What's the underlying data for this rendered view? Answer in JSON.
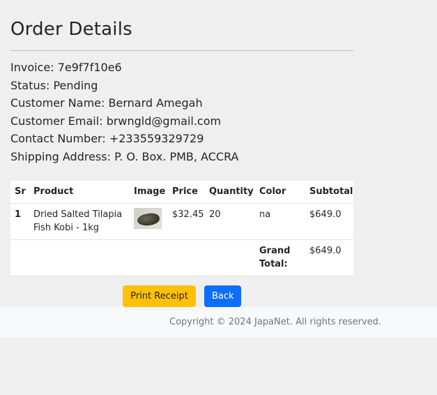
{
  "page": {
    "title": "Order Details"
  },
  "order": {
    "invoice_label": "Invoice:",
    "invoice": "7e9f7f10e6",
    "status_label": "Status:",
    "status": "Pending",
    "customer_name_label": "Customer Name:",
    "customer_name": "Bernard Amegah",
    "customer_email_label": "Customer Email:",
    "customer_email": "brwngld@gmail.com",
    "contact_label": "Contact Number:",
    "contact": "+233559329729",
    "address_label": "Shipping Address:",
    "address": "P. O. Box. PMB, ACCRA"
  },
  "table": {
    "headers": [
      "Sr",
      "Product",
      "Image",
      "Price",
      "Quantity",
      "Color",
      "Subtotal"
    ],
    "rows": [
      {
        "sr": "1",
        "product": "Dried Salted Tilapia Fish Kobi - 1kg",
        "image_icon": "fish-product-image",
        "price": "$32.45",
        "quantity": "20",
        "color": "na",
        "subtotal": "$649.0"
      }
    ],
    "grand_total_label": "Grand Total:",
    "grand_total": "$649.0"
  },
  "buttons": {
    "print": "Print Receipt",
    "back": "Back"
  },
  "footer": {
    "text": "Copyright © 2024 JapaNet. All rights reserved."
  },
  "colors": {
    "print_button": "#ffc107",
    "back_button": "#0d6efd",
    "background": "#efefef"
  }
}
